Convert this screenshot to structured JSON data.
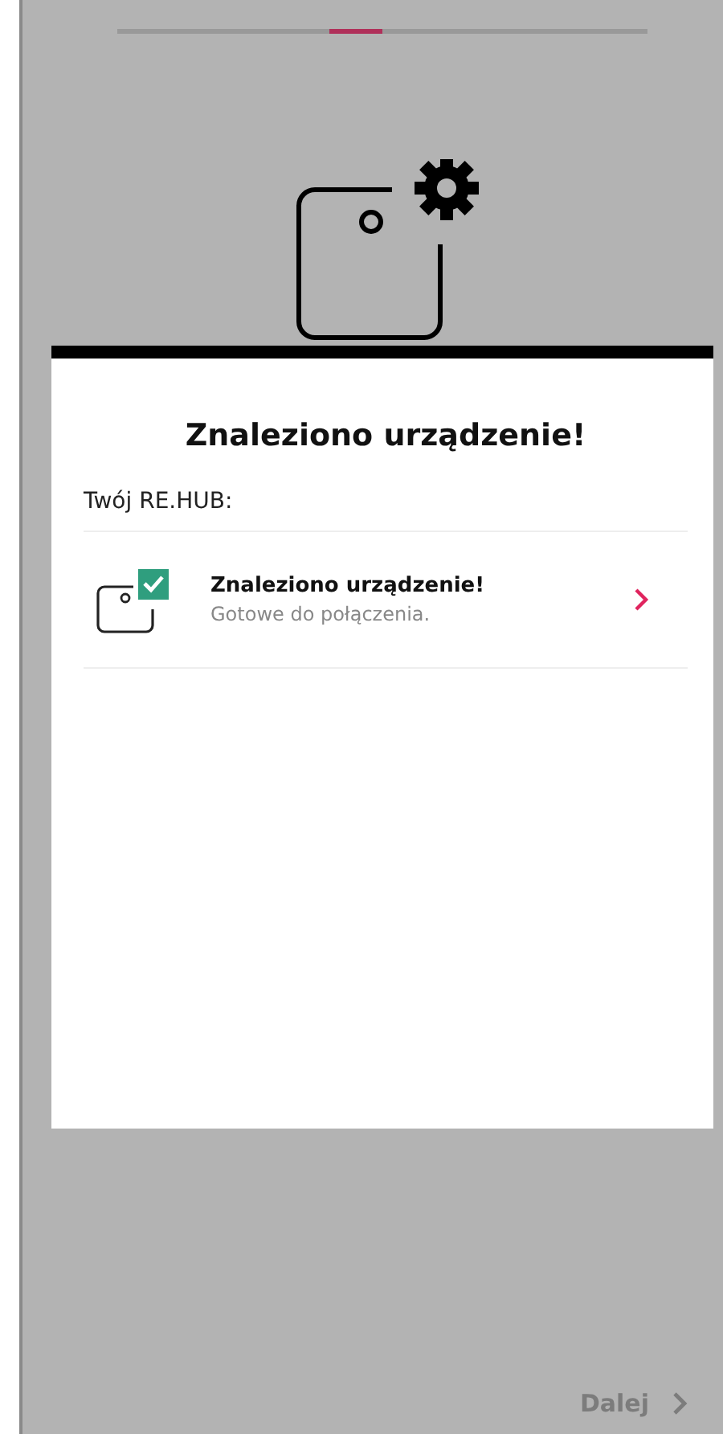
{
  "steps": [
    {
      "selected": false
    },
    {
      "selected": false
    },
    {
      "selected": false
    },
    {
      "selected": false
    },
    {
      "selected": true
    },
    {
      "selected": false
    },
    {
      "selected": false
    },
    {
      "selected": false
    },
    {
      "selected": false
    },
    {
      "selected": false
    }
  ],
  "card": {
    "title": "Znaleziono urządzenie!",
    "section_label": "Twój RE.HUB:",
    "devices": [
      {
        "title": "Znaleziono urządzenie!",
        "subtitle": "Gotowe do połączenia.",
        "checked": true
      }
    ]
  },
  "next_button": {
    "label": "Dalej",
    "disabled": true
  }
}
